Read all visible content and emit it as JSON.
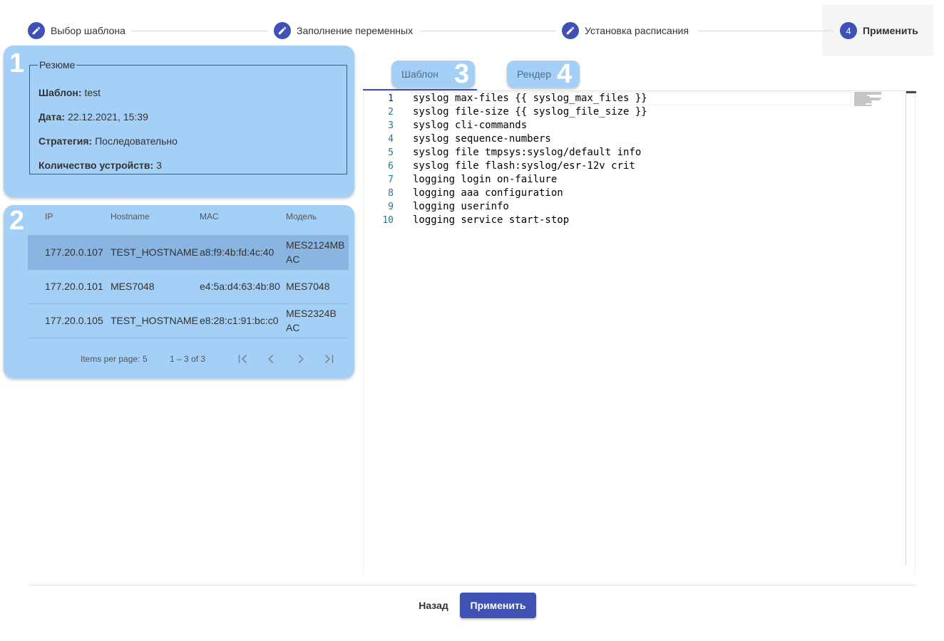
{
  "stepper": {
    "steps": [
      {
        "label": "Выбор шаблона",
        "icon": "pencil-icon",
        "state": "done"
      },
      {
        "label": "Заполнение переменных",
        "icon": "pencil-icon",
        "state": "done"
      },
      {
        "label": "Установка расписания",
        "icon": "pencil-icon",
        "state": "done"
      },
      {
        "label": "Применить",
        "number": "4",
        "state": "active"
      }
    ]
  },
  "annotations": {
    "card1": "1",
    "card2": "2",
    "tab1": "3",
    "tab2": "4"
  },
  "resume": {
    "legend": "Резюме",
    "template_label": "Шаблон:",
    "template_value": "test",
    "date_label": "Дата:",
    "date_value": "22.12.2021, 15:39",
    "strategy_label": "Стратегия:",
    "strategy_value": "Последовательно",
    "devices_label": "Количество устройств:",
    "devices_value": "3"
  },
  "devices": {
    "columns": [
      "IP",
      "Hostname",
      "MAC",
      "Модель"
    ],
    "rows": [
      {
        "ip": "177.20.0.107",
        "hostname": "TEST_HOSTNAME",
        "mac": "a8:f9:4b:fd:4c:40",
        "model": "MES2124MB AC",
        "model_lines": [
          "MES2124MB",
          "AC"
        ],
        "selected": true
      },
      {
        "ip": "177.20.0.101",
        "hostname": "MES7048",
        "mac": "e4:5a:d4:63:4b:80",
        "model": "MES7048",
        "model_lines": [
          "MES7048",
          ""
        ],
        "selected": false
      },
      {
        "ip": "177.20.0.105",
        "hostname": "TEST_HOSTNAME",
        "mac": "e8:28:c1:91:bc:c0",
        "model": "MES2324B AC",
        "model_lines": [
          "MES2324B",
          "AC"
        ],
        "selected": false
      }
    ],
    "paginator": {
      "items_per_page_label": "Items per page:",
      "items_per_page": "5",
      "range": "1 – 3 of 3"
    }
  },
  "tabs": [
    {
      "label": "Шаблон",
      "active": true
    },
    {
      "label": "Рендер",
      "active": false
    }
  ],
  "editor": {
    "lines": [
      "syslog max-files {{ syslog_max_files }}",
      "syslog file-size {{ syslog_file_size }}",
      "syslog cli-commands",
      "syslog sequence-numbers",
      "syslog file tmpsys:syslog/default info",
      "syslog file flash:syslog/esr-12v crit",
      "logging login on-failure",
      "logging aaa configuration",
      "logging userinfo",
      "logging service start-stop"
    ],
    "line_numbers": [
      "1",
      "2",
      "3",
      "4",
      "5",
      "6",
      "7",
      "8",
      "9",
      "10"
    ]
  },
  "footer": {
    "back_label": "Назад",
    "apply_label": "Применить"
  },
  "colors": {
    "primary": "#3f51b5",
    "card": "#a4cff6",
    "selected_row": "#8ab5e2"
  }
}
